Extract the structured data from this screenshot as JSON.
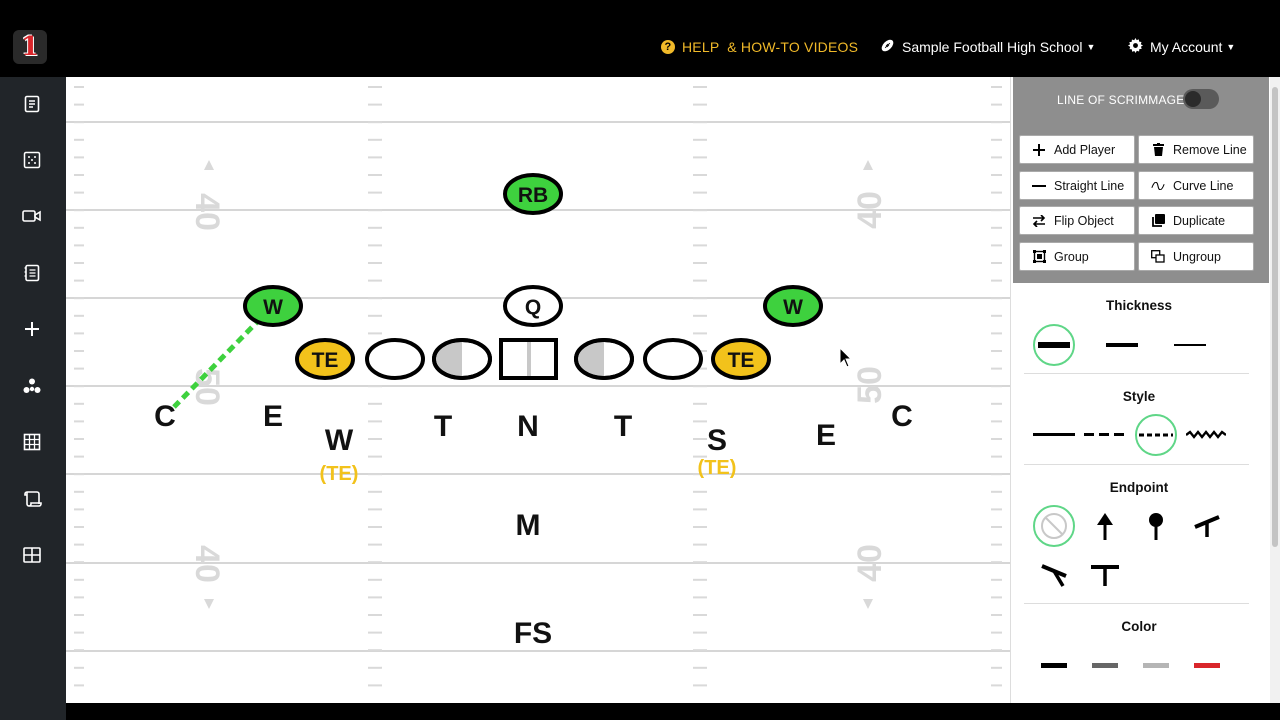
{
  "header": {
    "logo_text": "1",
    "help_label": "HELP  & HOW-TO VIDEOS",
    "school_label": "Sample Football High School",
    "account_label": "My Account"
  },
  "sidebar": {
    "items": [
      "playbook-icon",
      "formation-icon",
      "video-icon",
      "notes-icon",
      "add-icon",
      "group-icon",
      "grid-icon",
      "scroll-icon",
      "table-icon"
    ]
  },
  "field": {
    "yard_numbers": [
      "40",
      "50",
      "40"
    ],
    "offense": [
      {
        "label": "RB",
        "color": "#3ed13e"
      },
      {
        "label": "W",
        "color": "#3ed13e"
      },
      {
        "label": "Q",
        "color": "#ffffff"
      },
      {
        "label": "W",
        "color": "#3ed13e"
      },
      {
        "label": "TE",
        "color": "#f2c21b"
      },
      {
        "label": "TE",
        "color": "#f2c21b"
      }
    ],
    "defense": [
      "C",
      "E",
      "W",
      "T",
      "N",
      "T",
      "S",
      "E",
      "C",
      "M",
      "FS"
    ],
    "defense_tags": [
      "(TE)",
      "(TE)"
    ],
    "tag_color": "#f2c21b",
    "route_color": "#3ed13e"
  },
  "panel": {
    "los_label": "LINE OF SCRIMMAGE",
    "buttons": {
      "add_player": "Add Player",
      "remove_line": "Remove Line",
      "straight_line": "Straight Line",
      "curve_line": "Curve Line",
      "flip_object": "Flip Object",
      "duplicate": "Duplicate",
      "group": "Group",
      "ungroup": "Ungroup"
    },
    "thickness_title": "Thickness",
    "style_title": "Style",
    "endpoint_title": "Endpoint",
    "color_title": "Color",
    "colors": [
      "#000000",
      "#666666",
      "#b5b5b5",
      "#d9262b"
    ],
    "selected_color": "#5fd687"
  }
}
